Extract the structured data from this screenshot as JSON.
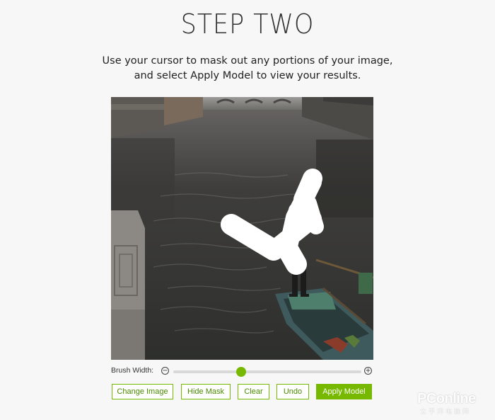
{
  "header": {
    "title": "STEP TWO",
    "instructions_line1": "Use your cursor to mask out any portions of your image,",
    "instructions_line2": "and select Apply Model to view your results."
  },
  "canvas": {
    "description_icon": "photo-canvas",
    "mask_color": "#ffffff"
  },
  "brush": {
    "label": "Brush Width:",
    "minus_symbol": "−",
    "plus_symbol": "+",
    "value_fraction": 0.36
  },
  "buttons": {
    "change_image": "Change Image",
    "hide_mask": "Hide Mask",
    "clear": "Clear",
    "undo": "Undo",
    "apply_model": "Apply Model"
  },
  "colors": {
    "accent": "#76b900"
  },
  "watermark": {
    "text": "PConline",
    "sub": "太平洋电脑网"
  }
}
